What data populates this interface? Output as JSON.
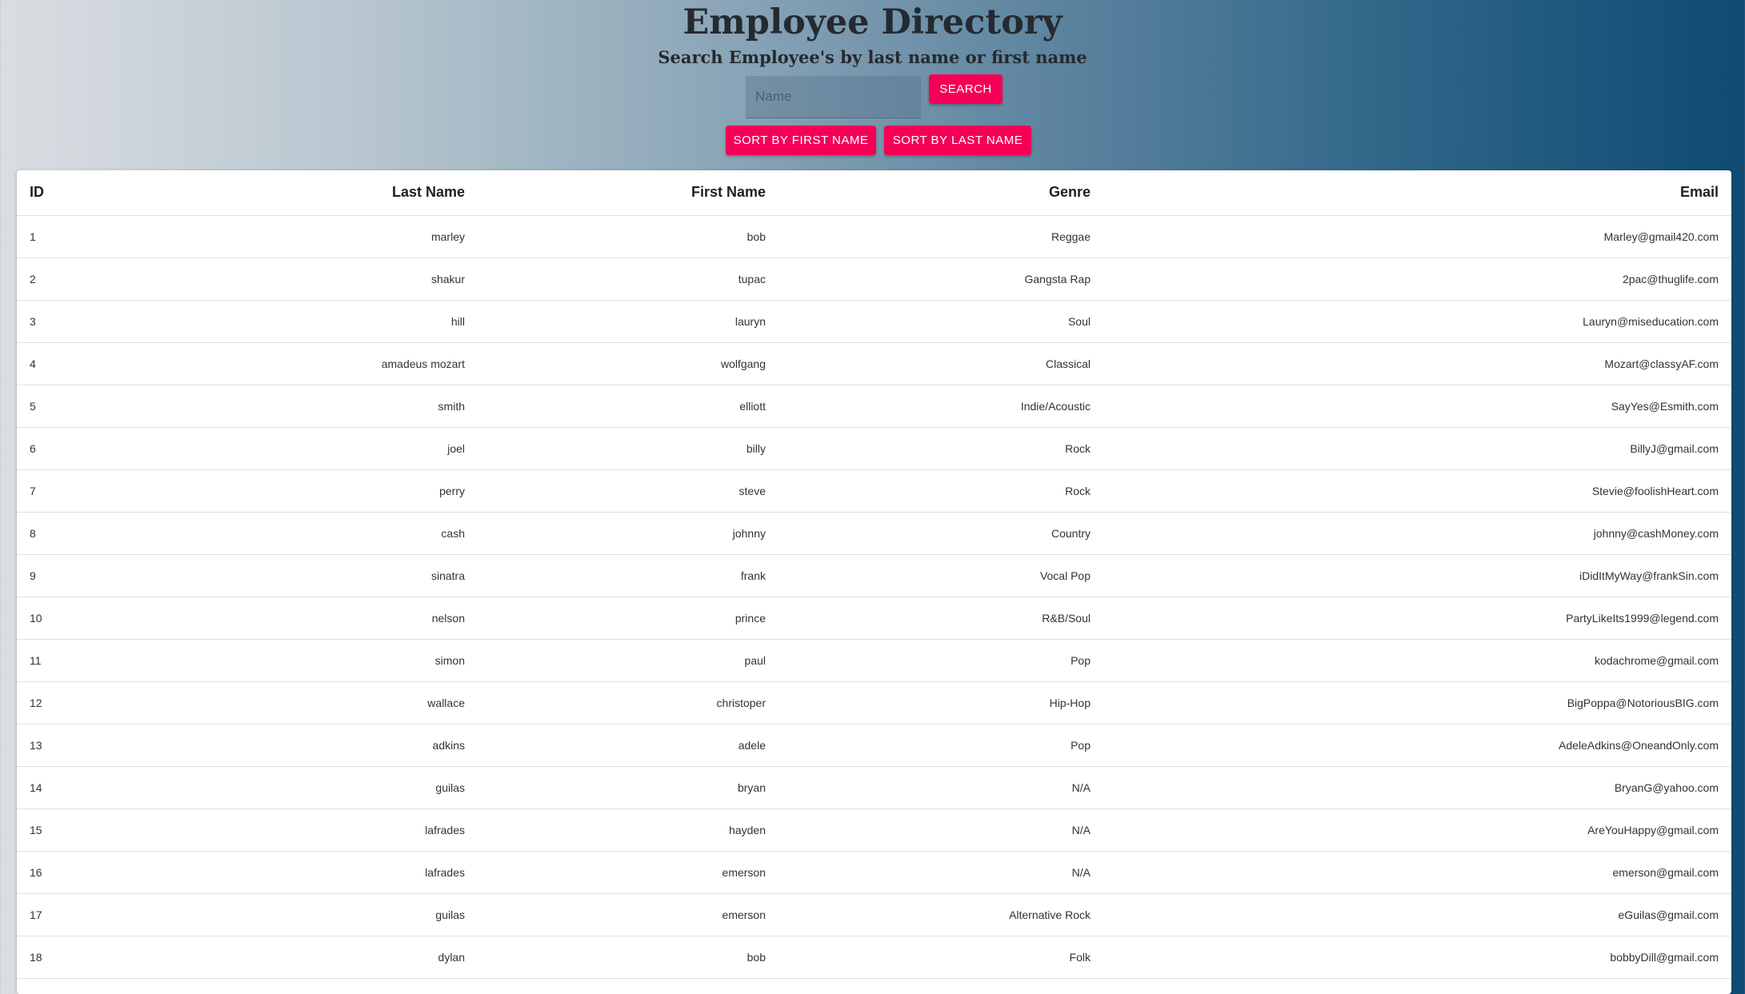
{
  "header": {
    "title": "Employee Directory",
    "subtitle": "Search Employee's by last name or first name"
  },
  "search": {
    "placeholder": "Name",
    "value": "",
    "button_label": "SEARCH"
  },
  "sort": {
    "first_name_label": "SORT BY FIRST NAME",
    "last_name_label": "SORT BY LAST NAME"
  },
  "colors": {
    "accent": "#f50057",
    "gradient_start": "#dadde2",
    "gradient_end": "#0f4a73"
  },
  "table": {
    "headers": {
      "id": "ID",
      "last": "Last Name",
      "first": "First Name",
      "genre": "Genre",
      "email": "Email"
    },
    "rows": [
      {
        "id": "1",
        "last": "marley",
        "first": "bob",
        "genre": "Reggae",
        "email": "Marley@gmail420.com"
      },
      {
        "id": "2",
        "last": "shakur",
        "first": "tupac",
        "genre": "Gangsta Rap",
        "email": "2pac@thuglife.com"
      },
      {
        "id": "3",
        "last": "hill",
        "first": "lauryn",
        "genre": "Soul",
        "email": "Lauryn@miseducation.com"
      },
      {
        "id": "4",
        "last": "amadeus mozart",
        "first": "wolfgang",
        "genre": "Classical",
        "email": "Mozart@classyAF.com"
      },
      {
        "id": "5",
        "last": "smith",
        "first": "elliott",
        "genre": "Indie/Acoustic",
        "email": "SayYes@Esmith.com"
      },
      {
        "id": "6",
        "last": "joel",
        "first": "billy",
        "genre": "Rock",
        "email": "BillyJ@gmail.com"
      },
      {
        "id": "7",
        "last": "perry",
        "first": "steve",
        "genre": "Rock",
        "email": "Stevie@foolishHeart.com"
      },
      {
        "id": "8",
        "last": "cash",
        "first": "johnny",
        "genre": "Country",
        "email": "johnny@cashMoney.com"
      },
      {
        "id": "9",
        "last": "sinatra",
        "first": "frank",
        "genre": "Vocal Pop",
        "email": "iDidItMyWay@frankSin.com"
      },
      {
        "id": "10",
        "last": "nelson",
        "first": "prince",
        "genre": "R&B/Soul",
        "email": "PartyLikeIts1999@legend.com"
      },
      {
        "id": "11",
        "last": "simon",
        "first": "paul",
        "genre": "Pop",
        "email": "kodachrome@gmail.com"
      },
      {
        "id": "12",
        "last": "wallace",
        "first": "christoper",
        "genre": "Hip-Hop",
        "email": "BigPoppa@NotoriousBIG.com"
      },
      {
        "id": "13",
        "last": "adkins",
        "first": "adele",
        "genre": "Pop",
        "email": "AdeleAdkins@OneandOnly.com"
      },
      {
        "id": "14",
        "last": "guilas",
        "first": "bryan",
        "genre": "N/A",
        "email": "BryanG@yahoo.com"
      },
      {
        "id": "15",
        "last": "lafrades",
        "first": "hayden",
        "genre": "N/A",
        "email": "AreYouHappy@gmail.com"
      },
      {
        "id": "16",
        "last": "lafrades",
        "first": "emerson",
        "genre": "N/A",
        "email": "emerson@gmail.com"
      },
      {
        "id": "17",
        "last": "guilas",
        "first": "emerson",
        "genre": "Alternative Rock",
        "email": "eGuilas@gmail.com"
      },
      {
        "id": "18",
        "last": "dylan",
        "first": "bob",
        "genre": "Folk",
        "email": "bobbyDill@gmail.com"
      }
    ]
  }
}
